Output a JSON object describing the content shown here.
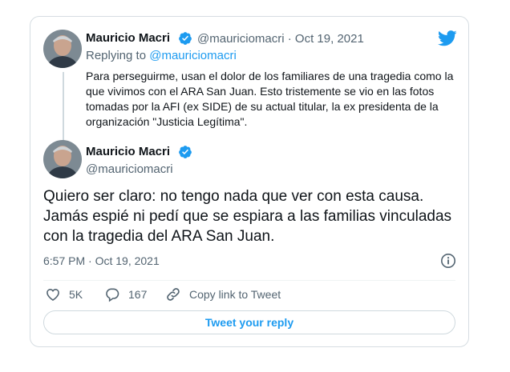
{
  "colors": {
    "accent": "#1d9bf0",
    "secondary_text": "#536471",
    "border": "#d6dde2"
  },
  "brand_icon": "twitter-bird-icon",
  "quoted_tweet": {
    "author_name": "Mauricio Macri",
    "handle": "@mauriciomacri",
    "separator": "·",
    "date": "Oct 19, 2021",
    "replying_prefix": "Replying to",
    "replying_to": "@mauriciomacri",
    "text": "Para perseguirme, usan el dolor de los familiares de una tragedia como la que vivimos con el ARA San Juan. Esto tristemente se vio en las fotos tomadas por la AFI (ex SIDE) de su actual titular, la ex presidenta de la organización \"Justicia Legítima\"."
  },
  "main_tweet": {
    "author_name": "Mauricio Macri",
    "handle": "@mauriciomacri",
    "text": "Quiero ser claro: no tengo nada que ver con esta causa. Jamás espié ni pedí que se espiara a las familias vinculadas con la tragedia del ARA San Juan.",
    "timestamp": "6:57 PM · Oct 19, 2021",
    "likes": "5K",
    "replies": "167",
    "copy_link_label": "Copy link to Tweet",
    "reply_button_label": "Tweet your reply"
  }
}
